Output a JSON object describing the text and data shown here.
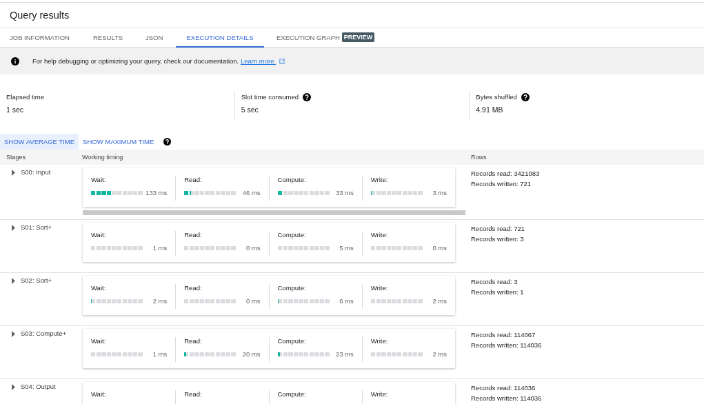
{
  "title": "Query results",
  "tabs": [
    {
      "label": "JOB INFORMATION",
      "selected": false
    },
    {
      "label": "RESULTS",
      "selected": false
    },
    {
      "label": "JSON",
      "selected": false
    },
    {
      "label": "EXECUTION DETAILS",
      "selected": true
    },
    {
      "label": "EXECUTION GRAPH",
      "selected": false,
      "badge": "PREVIEW"
    }
  ],
  "banner": {
    "text": "For help debugging or optimizing your query, check our documentation.",
    "link": "Learn more."
  },
  "metrics": [
    {
      "label": "Elapsed time",
      "value": "1 sec",
      "help": false
    },
    {
      "label": "Slot time consumed",
      "value": "5 sec",
      "help": true
    },
    {
      "label": "Bytes shuffled",
      "value": "4.91 MB",
      "help": true
    }
  ],
  "time_toggle": [
    {
      "label": "SHOW AVERAGE TIME",
      "selected": true
    },
    {
      "label": "SHOW MAXIMUM TIME",
      "selected": false
    }
  ],
  "table": {
    "columns": [
      "Stages",
      "Working timing",
      "Rows"
    ],
    "stages": [
      {
        "name": "S00: Input",
        "expanded": false,
        "scrollbar": true,
        "timings": [
          {
            "label": "Wait:",
            "level": 0.38,
            "reading": "133 ms"
          },
          {
            "label": "Read:",
            "level": 0.13,
            "reading": "46 ms"
          },
          {
            "label": "Compute:",
            "level": 0.1,
            "reading": "33 ms"
          },
          {
            "label": "Write:",
            "level": 0.01,
            "reading": "3 ms"
          }
        ],
        "rows": [
          "Records read: 3421083",
          "Records written: 721"
        ]
      },
      {
        "name": "S01: Sort+",
        "expanded": false,
        "scrollbar": false,
        "timings": [
          {
            "label": "Wait:",
            "level": 0,
            "reading": "1 ms"
          },
          {
            "label": "Read:",
            "level": 0,
            "reading": "0 ms"
          },
          {
            "label": "Compute:",
            "level": 0.01,
            "reading": "5 ms"
          },
          {
            "label": "Write:",
            "level": 0,
            "reading": "0 ms"
          }
        ],
        "rows": [
          "Records read: 721",
          "Records written: 3"
        ]
      },
      {
        "name": "S02: Sort+",
        "expanded": false,
        "scrollbar": false,
        "timings": [
          {
            "label": "Wait:",
            "level": 0.01,
            "reading": "2 ms"
          },
          {
            "label": "Read:",
            "level": 0,
            "reading": "0 ms"
          },
          {
            "label": "Compute:",
            "level": 0.02,
            "reading": "6 ms"
          },
          {
            "label": "Write:",
            "level": 0,
            "reading": "2 ms"
          }
        ],
        "rows": [
          "Records read: 3",
          "Records written: 1"
        ]
      },
      {
        "name": "S03: Compute+",
        "expanded": false,
        "scrollbar": false,
        "timings": [
          {
            "label": "Wait:",
            "level": 0,
            "reading": "1 ms"
          },
          {
            "label": "Read:",
            "level": 0.03,
            "reading": "20 ms"
          },
          {
            "label": "Compute:",
            "level": 0.04,
            "reading": "23 ms"
          },
          {
            "label": "Write:",
            "level": 0,
            "reading": "2 ms"
          }
        ],
        "rows": [
          "Records read: 114067",
          "Records written: 114036"
        ]
      },
      {
        "name": "S04: Output",
        "expanded": false,
        "scrollbar": false,
        "timings": [
          {
            "label": "Wait:"
          },
          {
            "label": "Read:"
          },
          {
            "label": "Compute:"
          },
          {
            "label": "Write:"
          }
        ],
        "rows": [
          "Records read: 114036",
          "Records written: 114036"
        ]
      }
    ]
  }
}
